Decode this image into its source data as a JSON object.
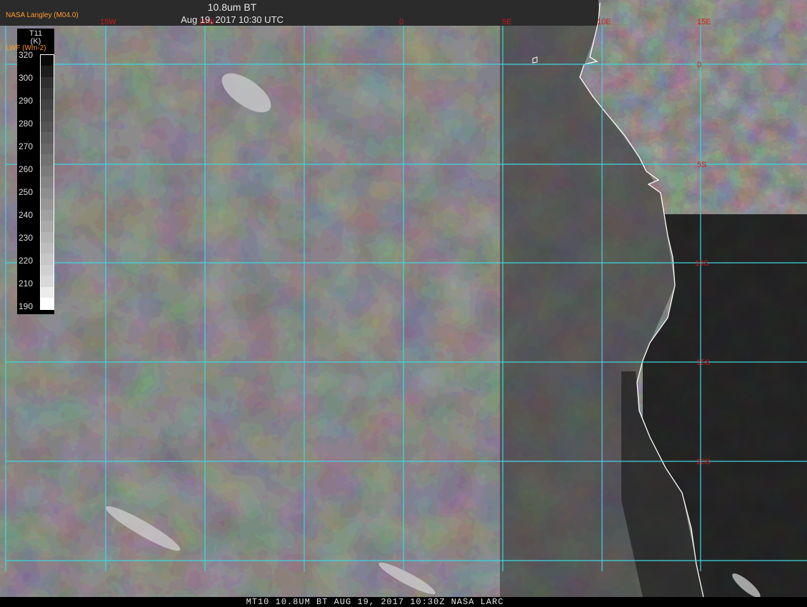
{
  "header": {
    "title": "10.8um BT",
    "datetime": "Aug 19, 2017 10:30 UTC",
    "source": "NASA Langley (M04.0)"
  },
  "legend": {
    "title_line1": "T11",
    "title_line2": "(K)",
    "flux_label": "LWF (Wm-2)",
    "ticks": [
      "320",
      "300",
      "290",
      "280",
      "270",
      "260",
      "250",
      "240",
      "230",
      "220",
      "210",
      "190"
    ],
    "ramp_values_K": [
      320,
      310,
      300,
      295,
      290,
      285,
      280,
      275,
      270,
      265,
      260,
      255,
      250,
      245,
      240,
      235,
      230,
      225,
      220,
      215,
      210,
      200,
      190
    ]
  },
  "grid": {
    "lon_labels": [
      "15W",
      "10W",
      "0",
      "5E",
      "10E",
      "15E"
    ],
    "lat_labels": [
      "0",
      "5S",
      "10S",
      "15S",
      "20S"
    ],
    "color": "#3fd5e0",
    "label_color": "#cc1a1a"
  },
  "map_colors": {
    "ocean": "#101010",
    "land": "#3c3c3c",
    "coast": "#ffffff"
  },
  "footer": {
    "caption": "MT10  10.8UM BT   AUG 19, 2017 10:30Z  NASA LARC"
  }
}
